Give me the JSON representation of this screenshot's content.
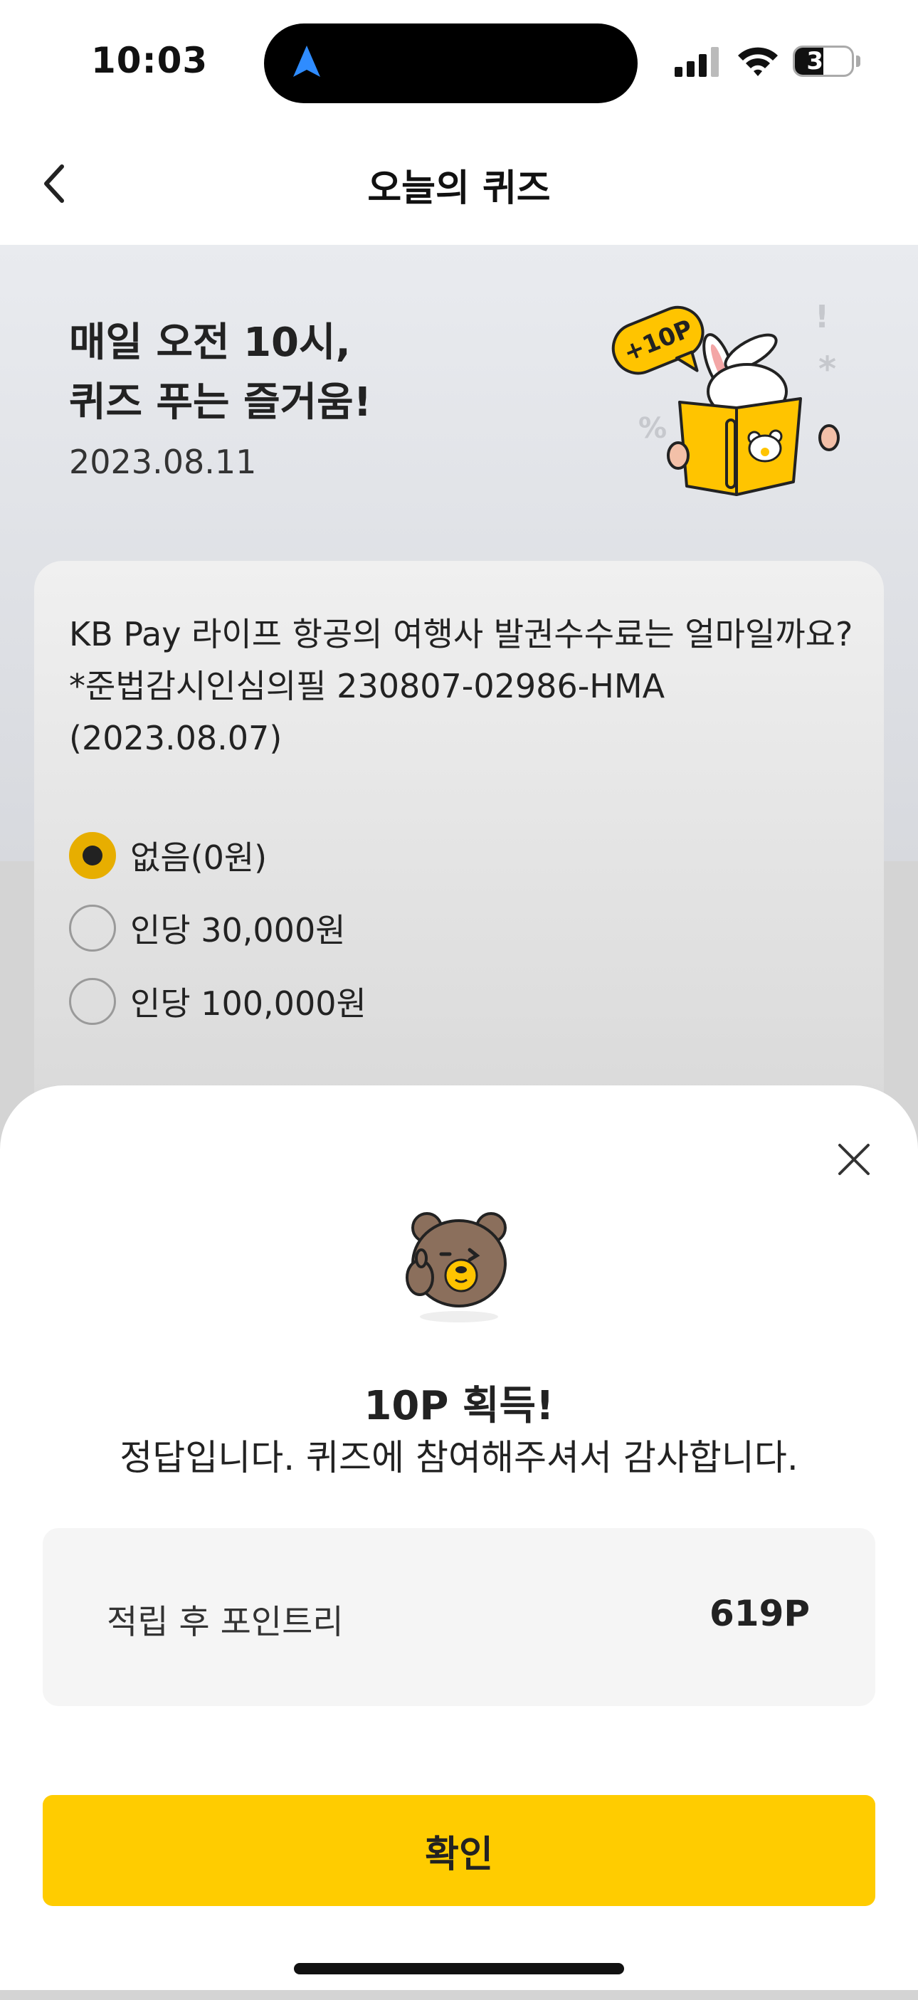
{
  "status": {
    "time": "10:03",
    "battery": "39"
  },
  "header": {
    "title": "오늘의 퀴즈"
  },
  "hero": {
    "title_line1": "매일 오전 10시,",
    "title_line2": "퀴즈 푸는 즐거움!",
    "date": "2023.08.11",
    "badge": "+10P"
  },
  "quiz": {
    "question_line1": "KB Pay 라이프 항공의 여행사 발권수수료는 얼마일까요?",
    "question_line2": "*준법감시인심의필 230807-02986-HMA",
    "question_line3": "(2023.08.07)",
    "options": [
      {
        "label": "없음(0원)",
        "selected": true
      },
      {
        "label": "인당 30,000원",
        "selected": false
      },
      {
        "label": "인당 100,000원",
        "selected": false
      }
    ]
  },
  "result": {
    "title": "10P 획득!",
    "message": "정답입니다. 퀴즈에 참여해주셔서 감사합니다.",
    "points_label": "적립 후 포인트리",
    "points_value": "619P",
    "confirm_label": "확인"
  },
  "colors": {
    "accent": "#ffcc00",
    "radio_selected": "#e7ae00"
  }
}
